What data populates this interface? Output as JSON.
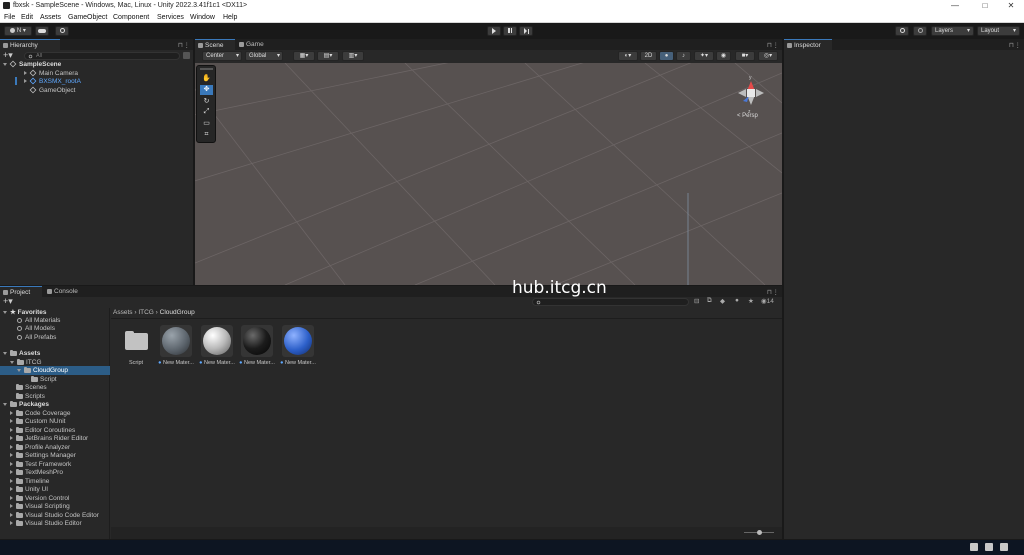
{
  "window": {
    "title": "fbxsk - SampleScene - Windows, Mac, Linux - Unity 2022.3.41f1c1 <DX11>",
    "controls": [
      "—",
      "□",
      "✕"
    ]
  },
  "menu": [
    "File",
    "Edit",
    "Assets",
    "GameObject",
    "Component",
    "Services",
    "Window",
    "Help"
  ],
  "toolbar": {
    "account": "N",
    "layers": "Layers",
    "layout": "Layout"
  },
  "hierarchy": {
    "tab": "Hierarchy",
    "search_placeholder": "All",
    "scene": "SampleScene",
    "items": [
      "Main Camera",
      "BXSMX_rootA",
      "GameObject"
    ]
  },
  "scene": {
    "tabs": [
      "Scene",
      "Game"
    ],
    "pivot": "Center",
    "space": "Global",
    "gizmo_label": "< Persp",
    "axis_labels": [
      "y",
      "z"
    ]
  },
  "inspector": {
    "tab": "Inspector"
  },
  "project": {
    "tabs": [
      "Project",
      "Console"
    ],
    "breadcrumb": [
      "Assets",
      "ITCG",
      "CloudGroup"
    ],
    "hidden_count": "14",
    "favorites": {
      "label": "Favorites",
      "items": [
        "All Materials",
        "All Models",
        "All Prefabs"
      ]
    },
    "assets_label": "Assets",
    "itcg": "ITCG",
    "cloudgroup": "CloudGroup",
    "script_folder": "Script",
    "scenes": "Scenes",
    "scripts": "Scripts",
    "packages_label": "Packages",
    "packages": [
      "Code Coverage",
      "Custom NUnit",
      "Editor Coroutines",
      "JetBrains Rider Editor",
      "Profile Analyzer",
      "Settings Manager",
      "Test Framework",
      "TextMeshPro",
      "Timeline",
      "Unity UI",
      "Version Control",
      "Visual Scripting",
      "Visual Studio Code Editor",
      "Visual Studio Editor"
    ],
    "asset_items": [
      {
        "label": "Script",
        "kind": "folder"
      },
      {
        "label": "New Mater...",
        "kind": "material",
        "color": "#5d656d"
      },
      {
        "label": "New Mater...",
        "kind": "material",
        "color": "#b9b9b9"
      },
      {
        "label": "New Mater...",
        "kind": "material",
        "color": "#1b1b1b"
      },
      {
        "label": "New Mater...",
        "kind": "material",
        "color": "#2c5fc9"
      }
    ]
  },
  "watermark": "hub.itcg.cn",
  "colors": {
    "accent": "#3a79bb",
    "selection": "#2c5d87",
    "scene_bg": "#575150"
  }
}
